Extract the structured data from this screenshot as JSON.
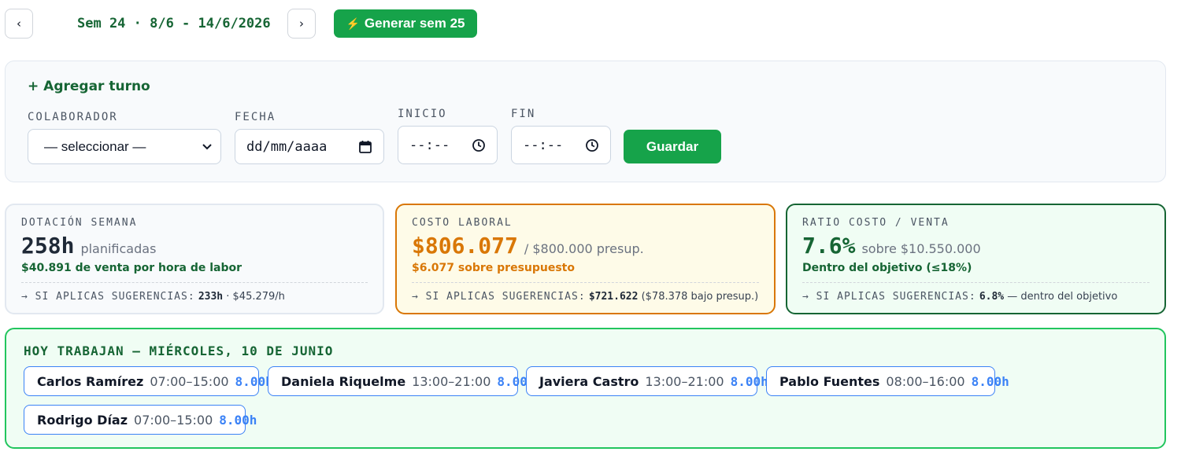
{
  "topbar": {
    "prev_icon": "‹",
    "next_icon": "›",
    "week_label": "Sem 24 · 8/6 - 14/6/2026",
    "generate_icon": "⚡",
    "generate_label": "Generar sem 25"
  },
  "add_shift": {
    "title": "+ Agregar turno",
    "fields": {
      "colaborador": {
        "label": "COLABORADOR",
        "value": "— seleccionar —"
      },
      "fecha": {
        "label": "FECHA",
        "value": "dd/mm/aaaa"
      },
      "inicio": {
        "label": "INICIO",
        "value": "--:--"
      },
      "fin": {
        "label": "FIN",
        "value": "--:--"
      }
    },
    "save_label": "Guardar"
  },
  "cards": {
    "dotacion": {
      "title": "DOTACIÓN SEMANA",
      "value": "258h",
      "suffix": "planificadas",
      "sub": "$40.891 de venta por hora de labor",
      "foot_label": "→ SI APLICAS SUGERENCIAS:",
      "foot_value": "233h",
      "foot_rest": "· $45.279/h"
    },
    "costo": {
      "title": "COSTO LABORAL",
      "value": "$806.077",
      "suffix": "/ $800.000 presup.",
      "sub": "$6.077 sobre presupuesto",
      "foot_label": "→ SI APLICAS SUGERENCIAS:",
      "foot_value": "$721.622",
      "foot_rest": "($78.378 bajo presup.)"
    },
    "ratio": {
      "title": "RATIO COSTO / VENTA",
      "value": "7.6%",
      "suffix": "sobre $10.550.000",
      "sub": "Dentro del objetivo (≤18%)",
      "foot_label": "→ SI APLICAS SUGERENCIAS:",
      "foot_value": "6.8%",
      "foot_rest": "— dentro del objetivo"
    }
  },
  "today": {
    "title": "HOY TRABAJAN — MIÉRCOLES, 10 DE JUNIO",
    "workers": [
      {
        "name": "Carlos Ramírez",
        "time": "07:00–15:00",
        "hours": "8.00h"
      },
      {
        "name": "Daniela Riquelme",
        "time": "13:00–21:00",
        "hours": "8.00h"
      },
      {
        "name": "Javiera Castro",
        "time": "13:00–21:00",
        "hours": "8.00h"
      },
      {
        "name": "Pablo Fuentes",
        "time": "08:00–16:00",
        "hours": "8.00h"
      },
      {
        "name": "Rodrigo Díaz",
        "time": "07:00–15:00",
        "hours": "8.00h"
      }
    ]
  },
  "colors": {
    "accent_green": "#16a34a",
    "dark_green": "#166534",
    "warning_orange": "#d97706",
    "chip_blue": "#3b82f6"
  },
  "icons": {
    "prev": "chevron-left-icon",
    "next": "chevron-right-icon",
    "generate": "lightning-icon",
    "select": "chevron-down-icon",
    "date": "calendar-icon",
    "time": "clock-icon"
  }
}
